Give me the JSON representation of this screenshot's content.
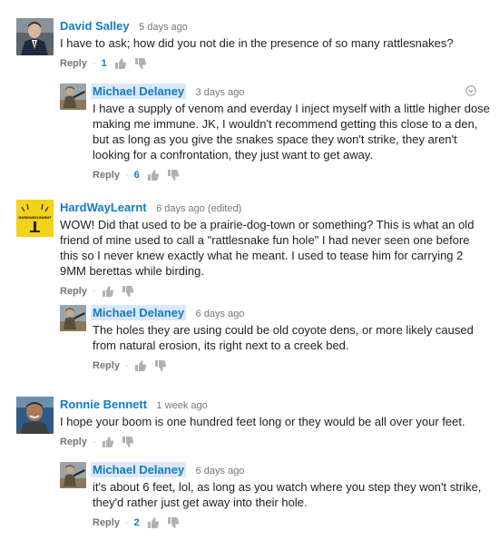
{
  "comments": [
    {
      "author": "David Salley",
      "time": "5 days ago",
      "text": "I have to ask; how did you not die in the presence of so many rattlesnakes?",
      "reply_label": "Reply",
      "likes": "1",
      "replies": [
        {
          "author": "Michael Delaney",
          "time": "3 days ago",
          "text": "I have a supply of venom and everday I inject myself with a little higher dose making me immune. JK, I wouldn't recommend getting this close to a den, but as long as you give the snakes space they won't strike, they aren't looking for a confrontation, they just want to get away.",
          "reply_label": "Reply",
          "likes": "6"
        }
      ]
    },
    {
      "author": "HardWayLearnt",
      "time": "6 days ago (edited)",
      "text": "WOW!  Did that used to be a prairie-dog-town or something?  This is what an old friend of mine used to call a \"rattlesnake fun hole\"  I had never seen one before this so I never knew exactly what he meant.  I used to tease him for carrying 2 9MM berettas while birding.",
      "reply_label": "Reply",
      "likes": "",
      "avatar_text": "HARDWAYLEARNT",
      "replies": [
        {
          "author": "Michael Delaney",
          "time": "6 days ago",
          "text": "The holes they are using could be old coyote dens, or more likely caused from natural erosion, its right next to a creek bed.",
          "reply_label": "Reply",
          "likes": ""
        }
      ]
    },
    {
      "author": "Ronnie Bennett",
      "time": "1 week ago",
      "text": "I hope your boom is one hundred feet long or they would be all over your feet.",
      "reply_label": "Reply",
      "likes": "",
      "replies": [
        {
          "author": "Michael Delaney",
          "time": "6 days ago",
          "text": "it's about 6 feet, lol, as long as you watch where you step they won't strike, they'd rather just get away into their hole.",
          "reply_label": "Reply",
          "likes": "2"
        }
      ]
    }
  ],
  "colors": {
    "author_link": "#167ac6",
    "author_highlight": "#dbe8f7",
    "meta": "#767676"
  },
  "icons": {
    "like": "thumb-up-icon",
    "dislike": "thumb-down-icon",
    "menu": "chevron-down-icon"
  }
}
